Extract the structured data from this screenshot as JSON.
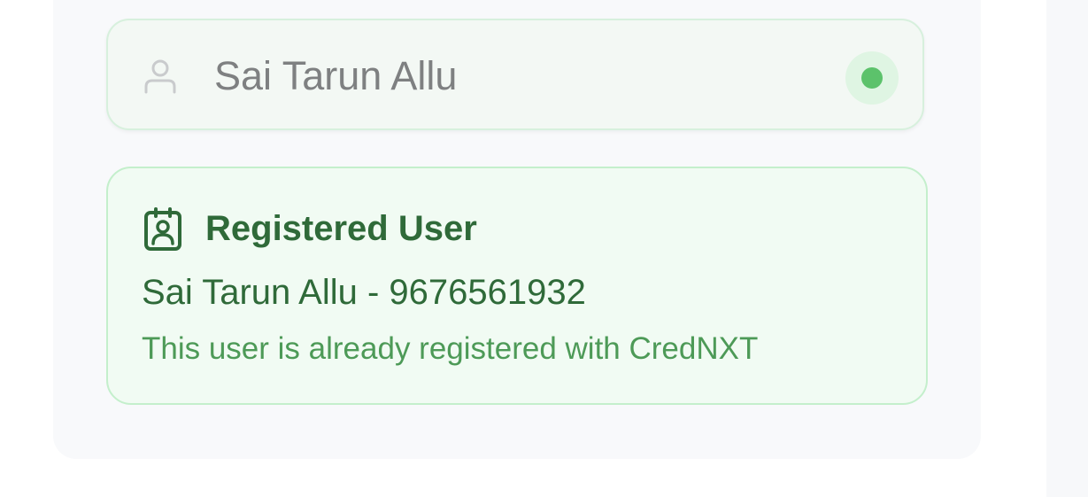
{
  "name_field": {
    "value": "Sai Tarun Allu",
    "icon": "user-icon",
    "status": "verified",
    "status_color": "#5cc26b"
  },
  "registered_card": {
    "icon": "id-badge-icon",
    "title": "Registered User",
    "user_line": "Sai Tarun Allu - 9676561932",
    "note": "This user is already registered with CredNXT"
  },
  "colors": {
    "accent_green": "#2f6a39",
    "card_background": "#f1fbf3",
    "card_border": "#c4efcc"
  }
}
